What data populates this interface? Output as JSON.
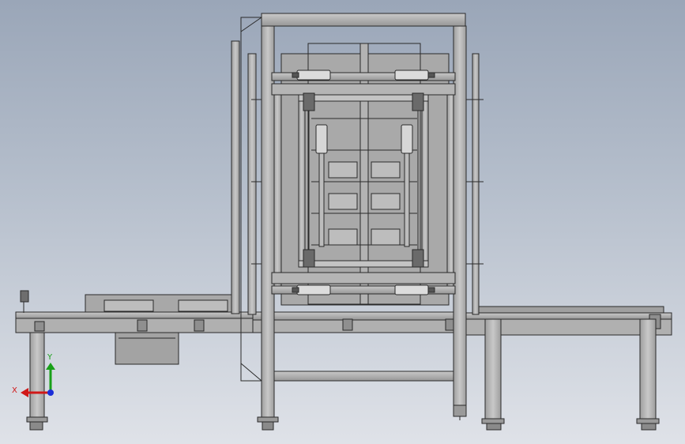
{
  "colors": {
    "background_top": "#9aa6b8",
    "background_bottom": "#dfe2e8",
    "steel": "#b4b4b4",
    "steel_dark": "#8c8c8c",
    "outline": "#2a2a2a",
    "axis_x": "#d01818",
    "axis_y": "#18a018",
    "axis_z": "#1a2ed8"
  },
  "triad": {
    "x_label": "X",
    "y_label": "Y"
  }
}
